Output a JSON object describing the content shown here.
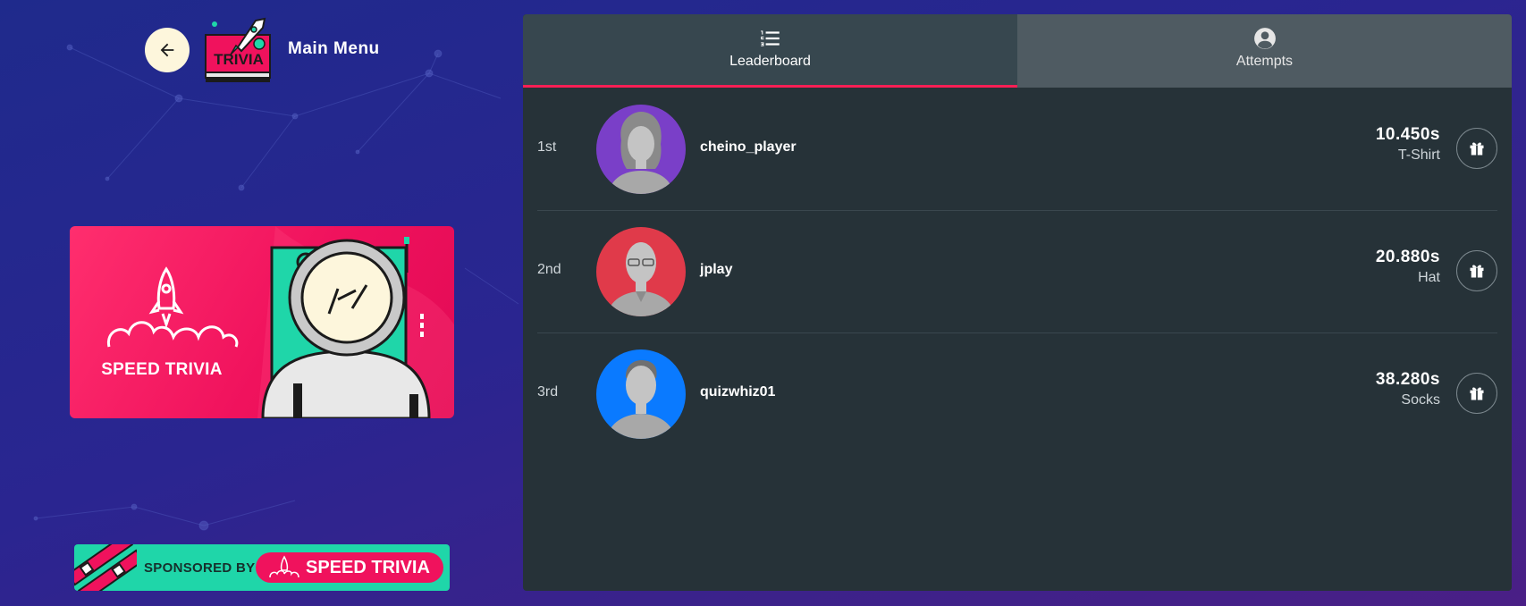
{
  "header": {
    "title": "Main Menu",
    "logo_text": "TRIVIA"
  },
  "banner": {
    "title": "SPEED TRIVIA"
  },
  "sponsor": {
    "label": "SPONSORED BY",
    "brand": "SPEED TRIVIA"
  },
  "tabs": [
    {
      "label": "Leaderboard",
      "icon": "list-numbered-icon",
      "active": true
    },
    {
      "label": "Attempts",
      "icon": "user-circle-icon",
      "active": false
    }
  ],
  "leaderboard": [
    {
      "rank": "1st",
      "username": "cheino_player",
      "time": "10.450s",
      "prize": "T-Shirt",
      "avatar_color": "#7a3fc8"
    },
    {
      "rank": "2nd",
      "username": "jplay",
      "time": "20.880s",
      "prize": "Hat",
      "avatar_color": "#e03a4a"
    },
    {
      "rank": "3rd",
      "username": "quizwhiz01",
      "time": "38.280s",
      "prize": "Socks",
      "avatar_color": "#0a7aff"
    }
  ],
  "colors": {
    "accent": "#ff1f55",
    "panel": "#263238",
    "sponsor_bg": "#1fd6a9",
    "banner_pink": "#f0125d"
  }
}
